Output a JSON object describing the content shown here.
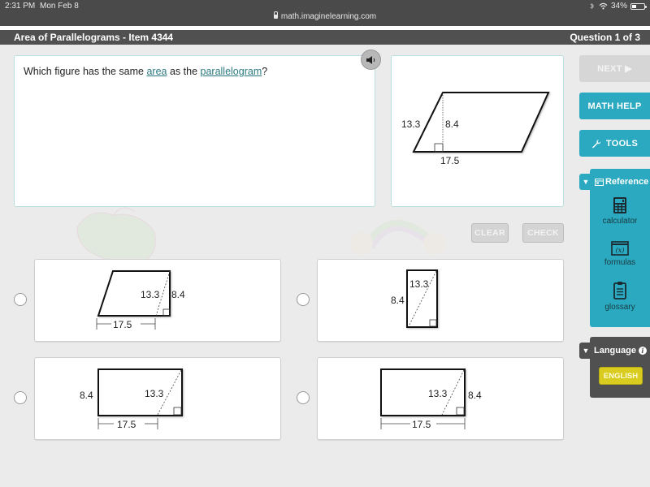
{
  "status_bar": {
    "time": "2:31 PM",
    "date": "Mon Feb 8",
    "battery": "34%",
    "battery_level": 0.34,
    "url": "math.imaginelearning.com"
  },
  "header": {
    "lesson_title": "Area of Parallelograms - Item 4344",
    "question_counter": "Question 1 of 3"
  },
  "question": {
    "prompt_before": "Which figure has the same ",
    "link1": "area",
    "prompt_middle": " as the ",
    "link2": "parallelogram",
    "prompt_after": "?",
    "audio_icon": "speaker-icon"
  },
  "given_figure": {
    "shape": "parallelogram",
    "side": "13.3",
    "height": "8.4",
    "base": "17.5"
  },
  "actions": {
    "clear": "CLEAR",
    "check": "CHECK"
  },
  "sidebar": {
    "next": "NEXT ▶",
    "math_help": "MATH HELP",
    "tools": "TOOLS",
    "tools_icon": "wrench-icon",
    "reference_title": "Reference",
    "reference_items": [
      {
        "label": "calculator",
        "icon": "calculator-icon"
      },
      {
        "label": "formulas",
        "icon": "formulas-icon"
      },
      {
        "label": "glossary",
        "icon": "clipboard-icon"
      }
    ],
    "language_title": "Language",
    "language_button": "ENGLISH"
  },
  "answers": [
    {
      "shape": "trapezoid",
      "base": "17.5",
      "diagonal": "13.3",
      "height": "8.4"
    },
    {
      "shape": "tall-rectangle",
      "diagonal": "13.3",
      "height": "8.4"
    },
    {
      "shape": "rectangle-left-label",
      "base": "17.5",
      "diagonal": "13.3",
      "height": "8.4"
    },
    {
      "shape": "rectangle-right-label",
      "base": "17.5",
      "diagonal": "13.3",
      "height": "8.4"
    }
  ]
}
